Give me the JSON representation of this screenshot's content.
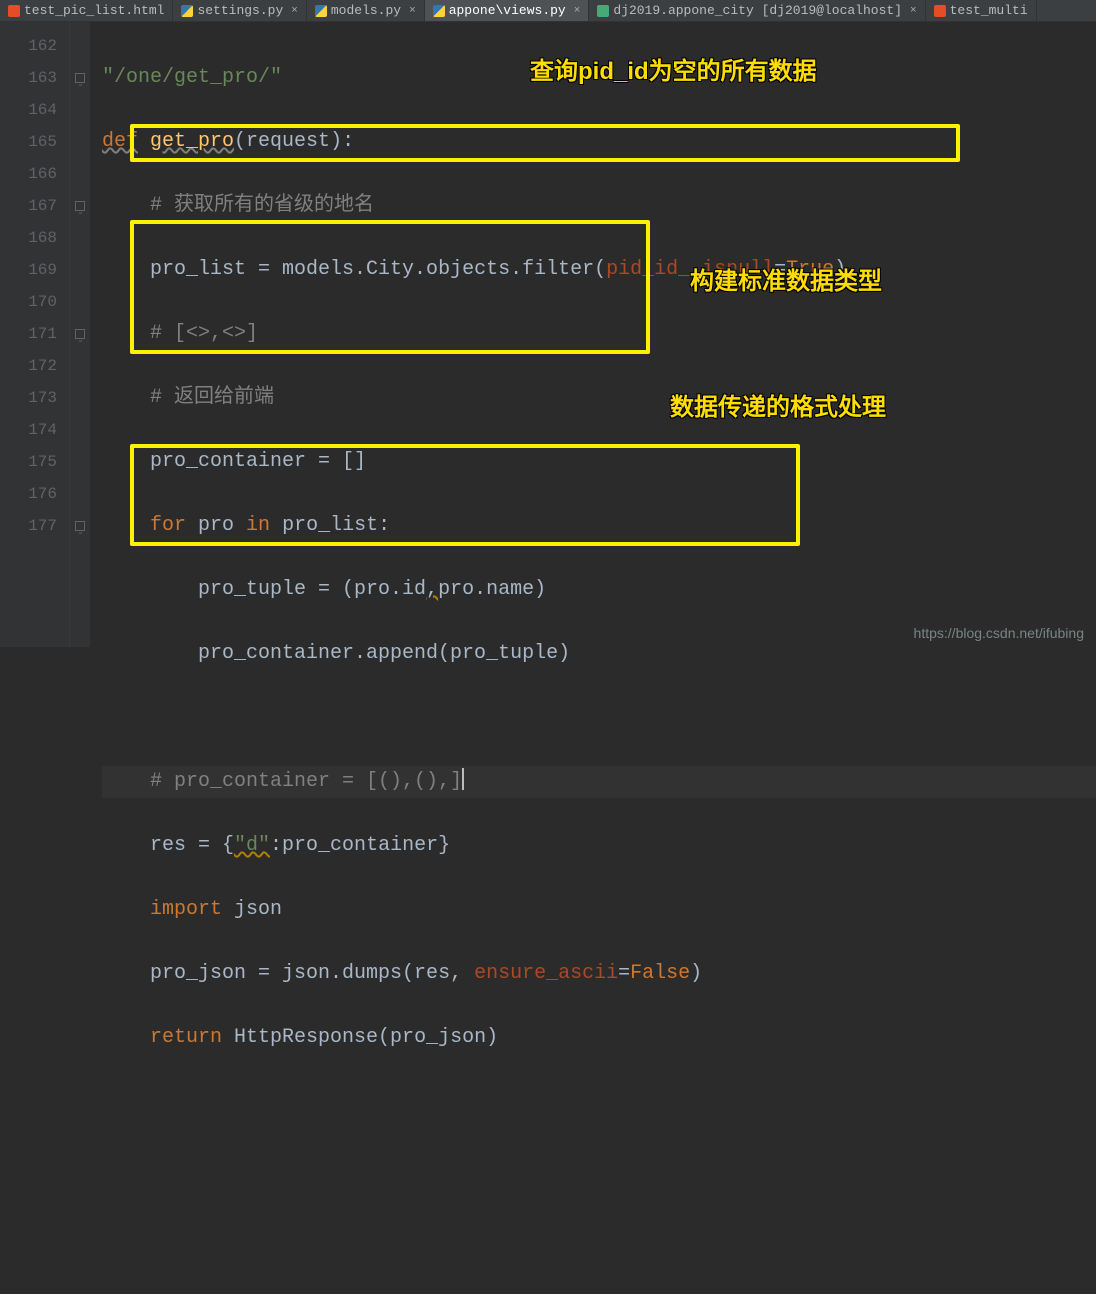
{
  "tabs": [
    {
      "label": "test_pic_list.html",
      "icon": "html"
    },
    {
      "label": "settings.py",
      "icon": "py"
    },
    {
      "label": "models.py",
      "icon": "py"
    },
    {
      "label": "appone\\views.py",
      "icon": "py",
      "active": true
    },
    {
      "label": "dj2019.appone_city [dj2019@localhost]",
      "icon": "db"
    },
    {
      "label": "test_multi",
      "icon": "html"
    }
  ],
  "gutter": [
    "162",
    "163",
    "164",
    "165",
    "166",
    "167",
    "168",
    "169",
    "170",
    "171",
    "172",
    "173",
    "174",
    "175",
    "176",
    "177"
  ],
  "code": {
    "l162": "\"/one/get_pro/\"",
    "l163_def": "def",
    "l163_fn": "get_pro",
    "l163_rest": "(request):",
    "l164": "# 获取所有的省级的地名",
    "l165_a": "pro_list = models.City.objects.filter(",
    "l165_p": "pid_id__isnull",
    "l165_b": "=",
    "l165_true": "True",
    "l165_c": ")",
    "l166": "# [<>,<>]",
    "l167": "# 返回给前端",
    "l168": "pro_container = []",
    "l169_for": "for",
    "l169_a": " pro ",
    "l169_in": "in",
    "l169_b": " pro_list:",
    "l170": "pro_tuple = (pro.id,pro.name)",
    "l170_comma_warn": ",",
    "l171": "pro_container.append(pro_tuple)",
    "l173": "# pro_container = [(),(),]",
    "l174_a": "res = {",
    "l174_s": "\"d\"",
    "l174_b": ":pro_container}",
    "l175_imp": "import",
    "l175_j": " json",
    "l176_a": "pro_json = json.dumps(res, ",
    "l176_p": "ensure_ascii",
    "l176_b": "=",
    "l176_false": "False",
    "l176_c": ")",
    "l177_ret": "return",
    "l177_a": " HttpResponse(pro_json)"
  },
  "annotations": {
    "a1": "查询pid_id为空的所有数据",
    "a2": "构建标准数据类型",
    "a3": "数据传递的格式处理"
  },
  "watermark": "https://blog.csdn.net/ifubing"
}
